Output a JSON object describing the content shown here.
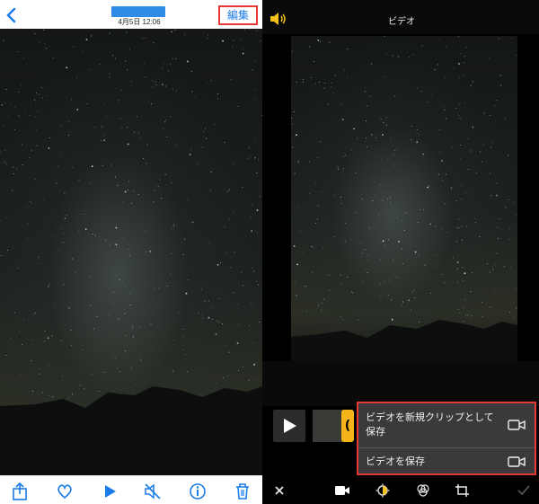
{
  "left_panel": {
    "header": {
      "date": "4月5日 12:06",
      "edit_label": "編集"
    },
    "toolbar": [
      "share-icon",
      "heart-icon",
      "play-icon",
      "mute-icon",
      "info-icon",
      "trash-icon"
    ]
  },
  "right_panel": {
    "header": {
      "title": "ビデオ"
    },
    "menu": {
      "save_as_new_clip": "ビデオを新規クリップとして保存",
      "save_video": "ビデオを保存"
    },
    "toolbar": [
      "close-icon",
      "video-camera-icon",
      "adjust-icon",
      "filters-icon",
      "crop-icon",
      "checkmark-icon"
    ]
  },
  "colors": {
    "accent": "#1a7ce8",
    "highlight": "#e53935",
    "trim_handle": "#f4b41a"
  }
}
